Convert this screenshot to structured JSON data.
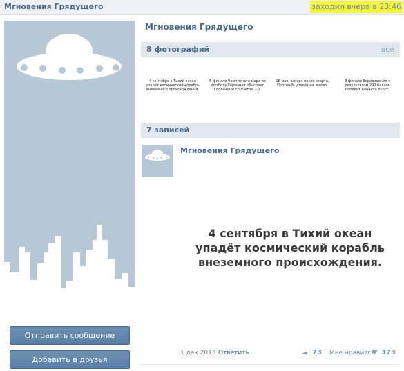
{
  "topbar": {
    "name": "Мгновения Грядущего",
    "online_status": "заходил вчера в 23:46"
  },
  "sidebar": {
    "send_message_label": "Отправить сообщение",
    "add_friend_label": "Добавить в друзья"
  },
  "main": {
    "title": "Мгновения Грядущего",
    "photos": {
      "header": "8 фотографий",
      "all_link": "все",
      "thumbs": [
        "4 сентября в Тихий океан упадёт космический корабль внеземного происхождения.",
        "В финале Чемпионата мира по футболу Германия обыграет Голландию со счетом 2-1.",
        "16 мая, вскоре после старта, Протон-М упадёт на землю.",
        "В финале Евровидения с результатом 290 баллов победит Кончита Вурст."
      ]
    },
    "wall": {
      "header": "7 записей",
      "post": {
        "author": "Мгновения Грядущего",
        "text": "4 сентября в Тихий океан упадёт космический корабль внеземного происхождения.",
        "date": "1 дек 2013",
        "separator": "|",
        "reply_label": "Ответить",
        "shares": "73",
        "like_label": "Мне нравится",
        "likes": "373"
      }
    }
  },
  "colors": {
    "link_blue": "#45688e",
    "avatar_bg": "#b7c7d6",
    "header_bg": "#e1e7ed",
    "highlight": "#f5f53a"
  },
  "icons": [
    "ufo-icon",
    "city-skyline-icon",
    "megaphone-icon",
    "heart-icon"
  ]
}
